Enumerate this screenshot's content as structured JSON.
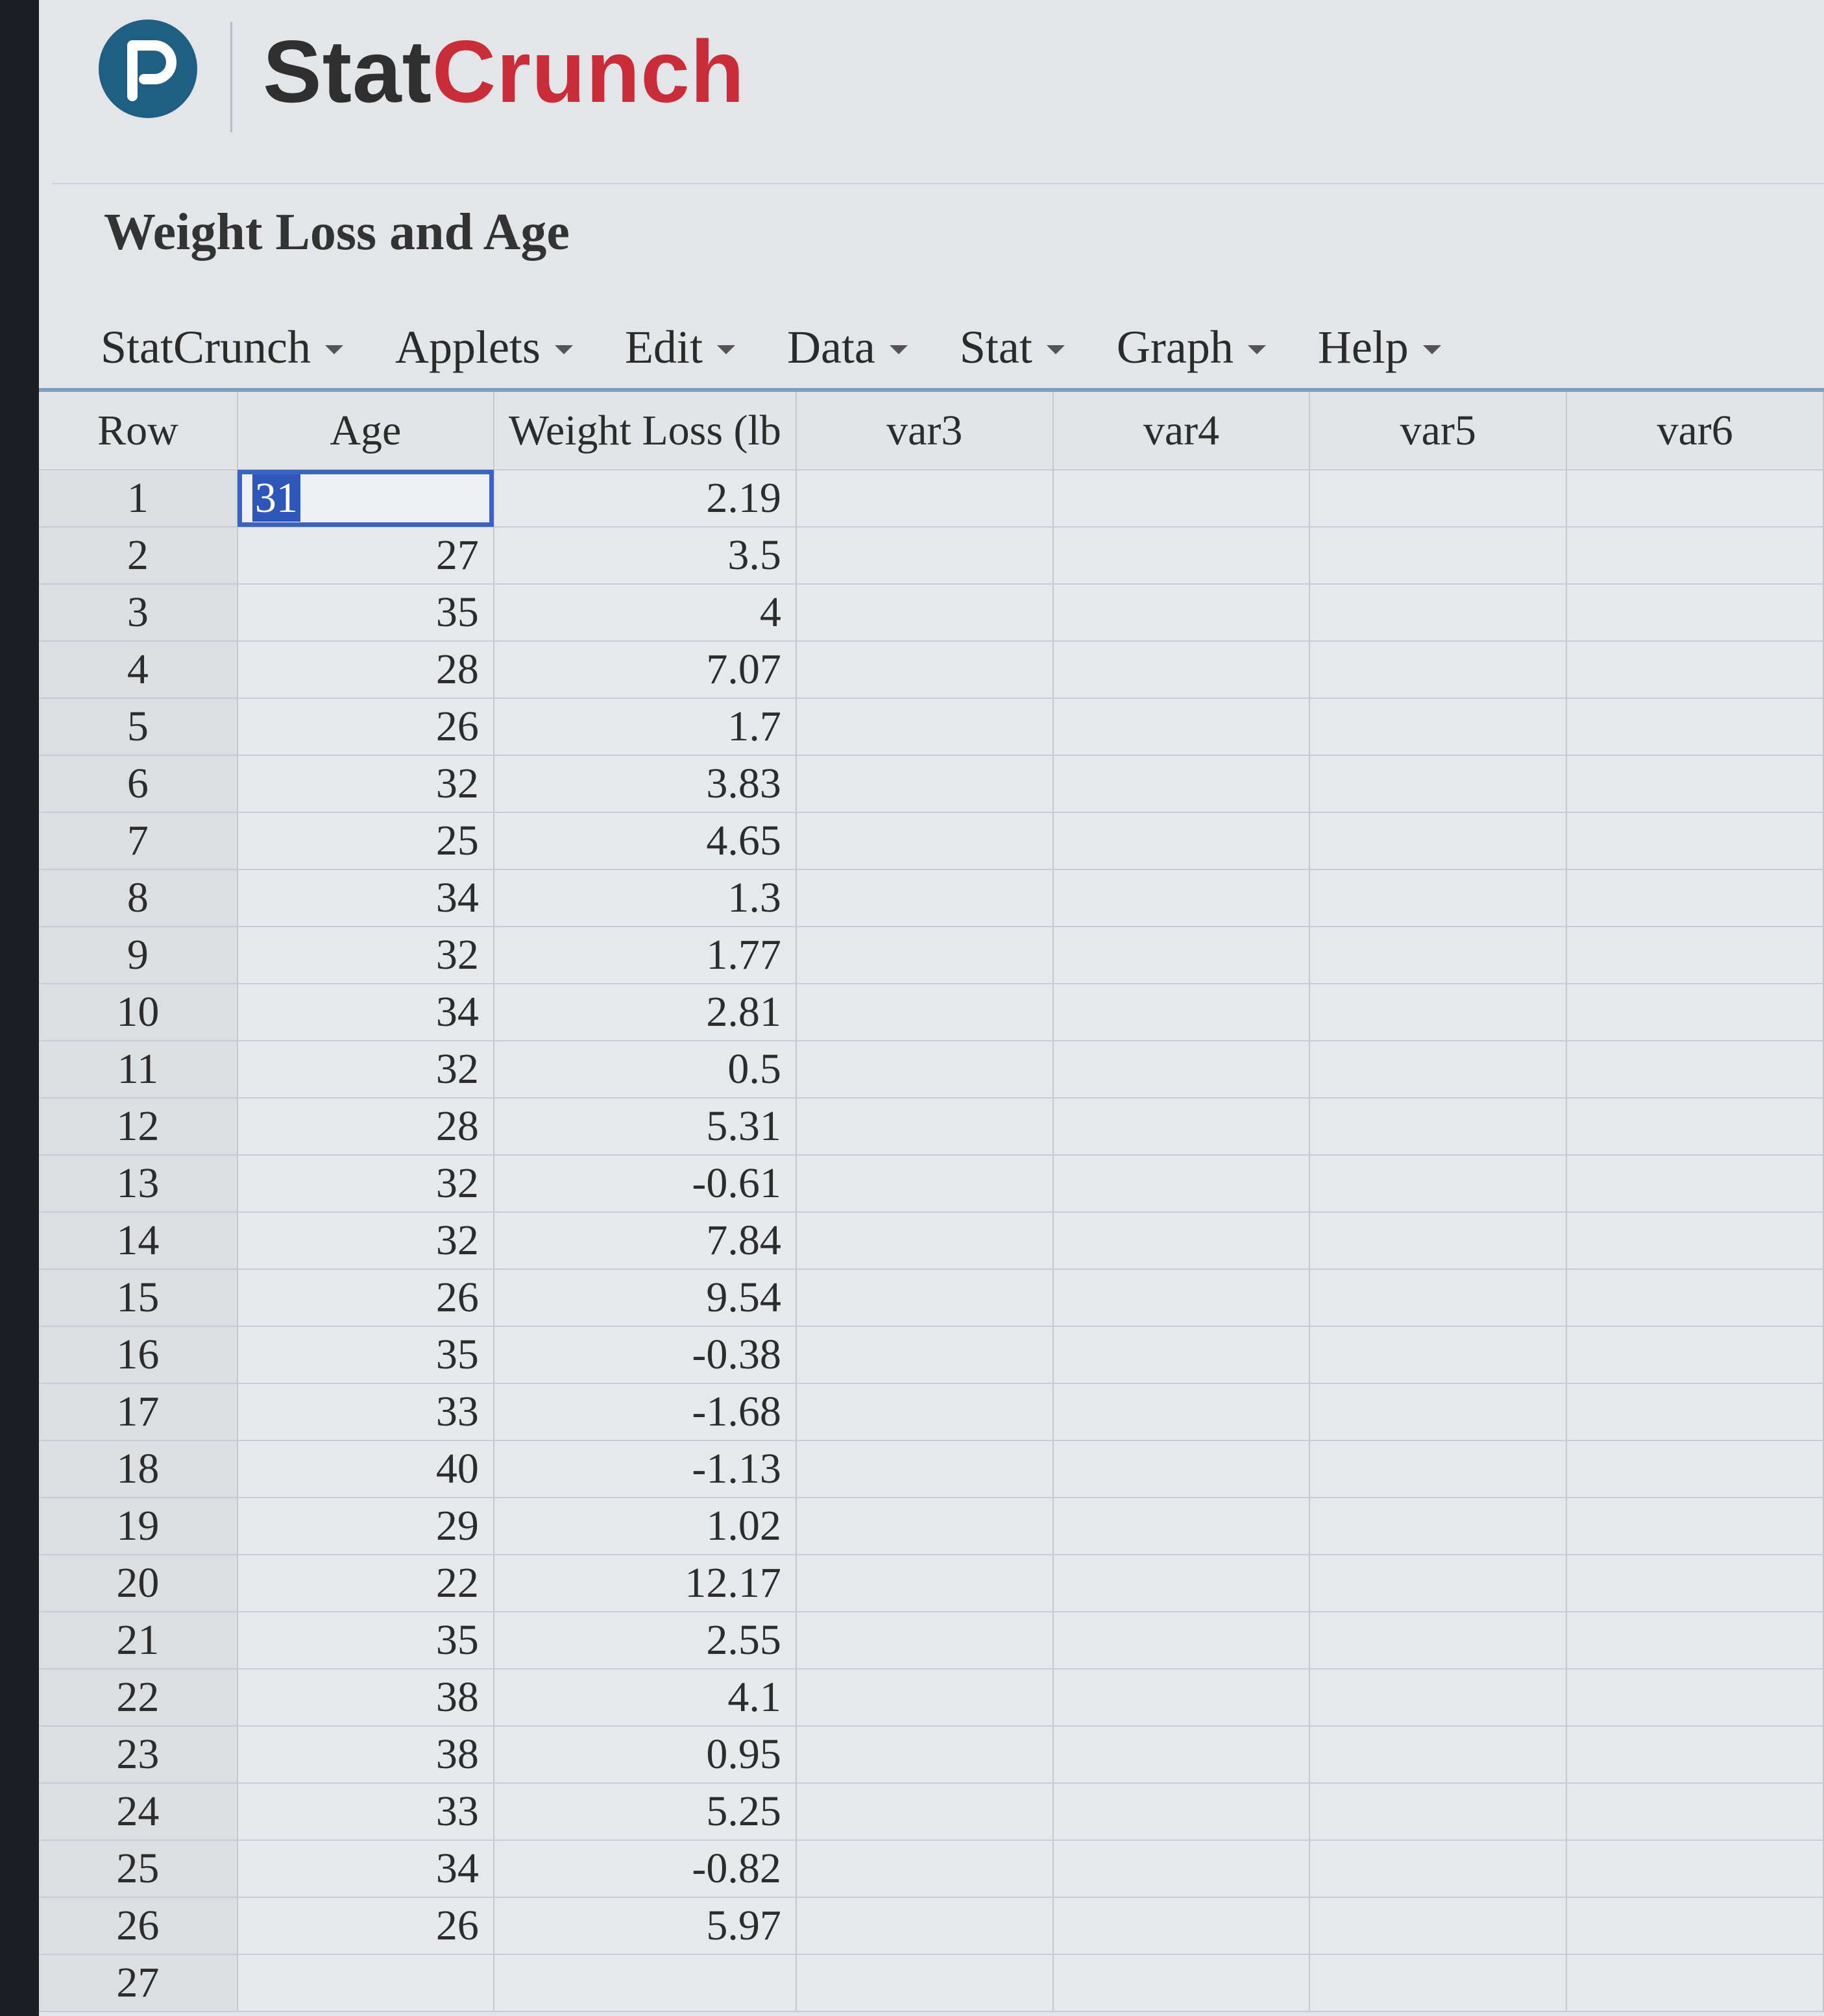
{
  "brand": {
    "part1": "Stat",
    "part2": "Crunch",
    "logo_letter": "P"
  },
  "page_title": "Weight Loss and Age",
  "menu": [
    {
      "label": "StatCrunch"
    },
    {
      "label": "Applets"
    },
    {
      "label": "Edit"
    },
    {
      "label": "Data"
    },
    {
      "label": "Stat"
    },
    {
      "label": "Graph"
    },
    {
      "label": "Help"
    }
  ],
  "columns": [
    "Row",
    "Age",
    "Weight Loss (lb",
    "var3",
    "var4",
    "var5",
    "var6"
  ],
  "rows": [
    {
      "row": "1",
      "age": "31",
      "wl": "2.19"
    },
    {
      "row": "2",
      "age": "27",
      "wl": "3.5"
    },
    {
      "row": "3",
      "age": "35",
      "wl": "4"
    },
    {
      "row": "4",
      "age": "28",
      "wl": "7.07"
    },
    {
      "row": "5",
      "age": "26",
      "wl": "1.7"
    },
    {
      "row": "6",
      "age": "32",
      "wl": "3.83"
    },
    {
      "row": "7",
      "age": "25",
      "wl": "4.65"
    },
    {
      "row": "8",
      "age": "34",
      "wl": "1.3"
    },
    {
      "row": "9",
      "age": "32",
      "wl": "1.77"
    },
    {
      "row": "10",
      "age": "34",
      "wl": "2.81"
    },
    {
      "row": "11",
      "age": "32",
      "wl": "0.5"
    },
    {
      "row": "12",
      "age": "28",
      "wl": "5.31"
    },
    {
      "row": "13",
      "age": "32",
      "wl": "-0.61"
    },
    {
      "row": "14",
      "age": "32",
      "wl": "7.84"
    },
    {
      "row": "15",
      "age": "26",
      "wl": "9.54"
    },
    {
      "row": "16",
      "age": "35",
      "wl": "-0.38"
    },
    {
      "row": "17",
      "age": "33",
      "wl": "-1.68"
    },
    {
      "row": "18",
      "age": "40",
      "wl": "-1.13"
    },
    {
      "row": "19",
      "age": "29",
      "wl": "1.02"
    },
    {
      "row": "20",
      "age": "22",
      "wl": "12.17"
    },
    {
      "row": "21",
      "age": "35",
      "wl": "2.55"
    },
    {
      "row": "22",
      "age": "38",
      "wl": "4.1"
    },
    {
      "row": "23",
      "age": "38",
      "wl": "0.95"
    },
    {
      "row": "24",
      "age": "33",
      "wl": "5.25"
    },
    {
      "row": "25",
      "age": "34",
      "wl": "-0.82"
    },
    {
      "row": "26",
      "age": "26",
      "wl": "5.97"
    },
    {
      "row": "27",
      "age": "",
      "wl": ""
    }
  ],
  "colors": {
    "accent_blue": "#3b63c4",
    "brand_red": "#c92d39",
    "logo_blue": "#1f5f84"
  }
}
